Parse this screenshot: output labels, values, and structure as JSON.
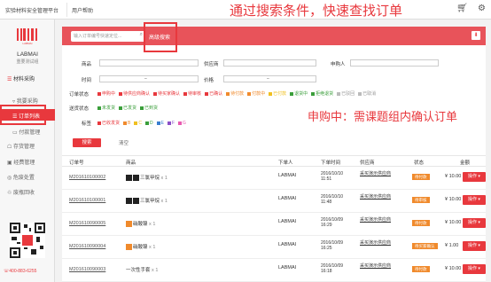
{
  "topbar": {
    "brand": "实验材料安全管理平台",
    "help": "用户帮助",
    "annotation": "通过搜索条件，快速查找订单"
  },
  "sidebar": {
    "user": "LABMAI",
    "org": "重要测试组",
    "logo_text": "LABMAI",
    "items": [
      {
        "label": "材料采购"
      },
      {
        "label": "我要采购"
      },
      {
        "label": "订单列表"
      },
      {
        "label": "付款管理"
      },
      {
        "label": "存货管理"
      },
      {
        "label": "经费管理"
      },
      {
        "label": "危废处置"
      },
      {
        "label": "废瓶回收"
      }
    ],
    "phone": "400-883-6255"
  },
  "search": {
    "placeholder": "输入订单编号快速定位...",
    "advanced": "高级搜索"
  },
  "filters": {
    "goods": "商品",
    "supplier": "供应商",
    "applicant": "申购人",
    "time": "时间",
    "price": "价格",
    "order_status": "订单状态",
    "delivery_status": "送货状态",
    "tags": "标签",
    "order_status_items": [
      {
        "label": "申购中",
        "color": "#e8383d"
      },
      {
        "label": "待供应商确认",
        "color": "#e8383d"
      },
      {
        "label": "待买家确认",
        "color": "#e8383d"
      },
      {
        "label": "待审核",
        "color": "#e8383d"
      },
      {
        "label": "已确认",
        "color": "#e8383d"
      },
      {
        "label": "待付款",
        "color": "#f08a2c"
      },
      {
        "label": "付款中",
        "color": "#f08a2c"
      },
      {
        "label": "已付款",
        "color": "#f0c020"
      },
      {
        "label": "退货中",
        "color": "#3a9e3a"
      },
      {
        "label": "拒绝退货",
        "color": "#3a9e3a"
      },
      {
        "label": "已驳回",
        "color": "#bbbbbb"
      },
      {
        "label": "已取消",
        "color": "#bbbbbb"
      }
    ],
    "delivery_items": [
      {
        "label": "未发货",
        "color": "#3a9e3a"
      },
      {
        "label": "已发货",
        "color": "#3a9e3a"
      },
      {
        "label": "已到货",
        "color": "#3a9e3a"
      }
    ],
    "tag_items": [
      {
        "label": "已收发货",
        "color": "#e8383d"
      },
      {
        "label": "B",
        "color": "#f08a2c"
      },
      {
        "label": "C",
        "color": "#f0c020"
      },
      {
        "label": "D",
        "color": "#3a9e3a"
      },
      {
        "label": "E",
        "color": "#3a7fd0"
      },
      {
        "label": "F",
        "color": "#8a4fc8"
      },
      {
        "label": "G",
        "color": "#e85ab0"
      }
    ],
    "search_button": "搜索",
    "clear_button": "清空",
    "annotation": "申购中：需课题组内确认订单"
  },
  "table": {
    "columns": [
      "订单号",
      "商品",
      "下单人",
      "下单时间",
      "供应商",
      "状态",
      "金额"
    ],
    "rows": [
      {
        "order": "M201610100002",
        "product": "三氯甲烷",
        "qty": "x 1",
        "buyer": "LABMAI",
        "date": "2016/10/10",
        "time": "11:51",
        "supplier": "采买演示供应商",
        "status": "待付款",
        "amount": "¥ 10.00",
        "op": "操作"
      },
      {
        "order": "M201610100001",
        "product": "三氯甲烷",
        "qty": "x 1",
        "buyer": "LABMAI",
        "date": "2016/10/10",
        "time": "11:48",
        "supplier": "采买演示供应商",
        "status": "待审核",
        "amount": "¥ 10.00",
        "op": "操作"
      },
      {
        "order": "M201610090005",
        "product": "硝酸镍",
        "qty": "x 1",
        "buyer": "LABMAI",
        "date": "2016/10/09",
        "time": "16:29",
        "supplier": "采买演示供应商",
        "status": "待付款",
        "amount": "¥ 10.00",
        "op": "操作"
      },
      {
        "order": "M201610090004",
        "product": "硝酸镍",
        "qty": "x 1",
        "buyer": "LABMAI",
        "date": "2016/10/09",
        "time": "16:25",
        "supplier": "采买演示供应商",
        "status": "待买家确认",
        "amount": "¥ 1.00",
        "op": "操作"
      },
      {
        "order": "M201610090003",
        "product": "一次性手套",
        "qty": "x 1",
        "buyer": "LABMAI",
        "date": "2016/10/09",
        "time": "16:18",
        "supplier": "采买演示供应商",
        "status": "待付款",
        "amount": "¥ 10.00",
        "op": "操作"
      }
    ]
  }
}
